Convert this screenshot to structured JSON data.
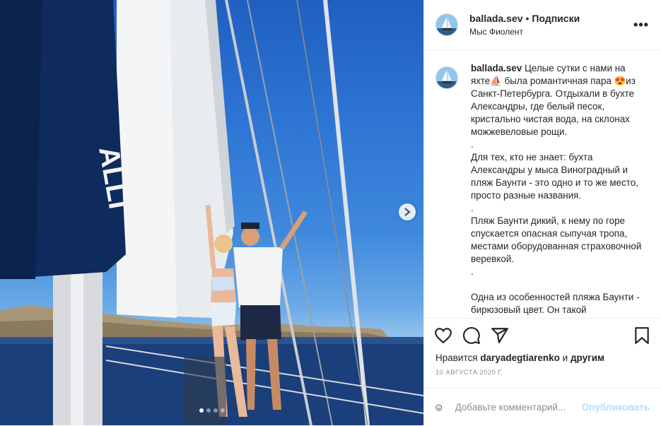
{
  "post": {
    "username": "ballada.sev",
    "separator": "•",
    "follow_label": "Подписки",
    "location": "Мыс Фиолент",
    "more_label": "•••"
  },
  "caption": {
    "username": "ballada.sev",
    "paragraphs": [
      "Целые сутки с нами на яхте⛵ была романтичная пара 😍из Санкт-Петербурга. Отдыхали в бухте Александры, где белый песок, кристально чистая вода, на склонах можжевеловые рощи.",
      ".",
      "Для тех, кто не знает: бухта Александры у мыса Виноградный и пляж Баунти - это одно и то же место, просто разные названия.",
      ".",
      "Пляж Баунти дикий, к нему по горе спускается опасная сыпучая тропа, местами оборудованная страховочной веревкой.",
      ".",
      "Одна из особенностей пляжа Баунти - бирюзовый цвет. Он такой"
    ]
  },
  "likes": {
    "prefix": "Нравится",
    "name": "daryadegtiarenko",
    "middle": "и",
    "others": "другим"
  },
  "date": "10 АВГУСТА 2020 Г.",
  "comment": {
    "placeholder": "Добавьте комментарий...",
    "publish_label": "Опубликовать"
  },
  "carousel": {
    "count": 4,
    "active": 0
  },
  "colors": {
    "publish_disabled": "#b2dffc",
    "muted": "#8e8e8e",
    "border": "#efefef"
  },
  "icons": [
    "heart-icon",
    "comment-icon",
    "share-icon",
    "bookmark-icon",
    "emoji-icon",
    "chevron-right-icon",
    "more-icon"
  ]
}
